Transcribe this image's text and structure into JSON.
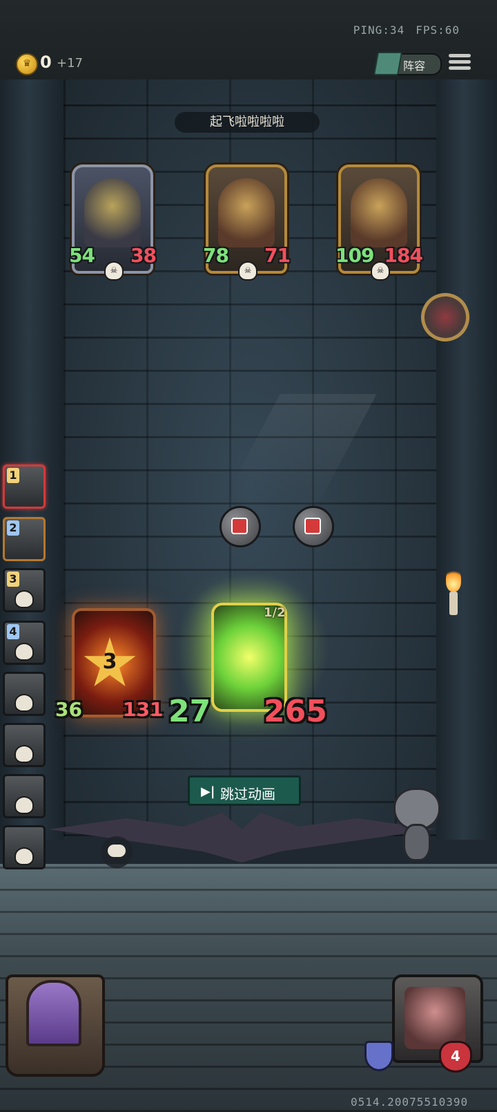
{
  "hud": {
    "ping": "PING:34",
    "fps": "FPS:60",
    "coins": "0",
    "coin_delta": "+17",
    "lineup_label": "阵容"
  },
  "banner": "起飞啦啦啦啦",
  "enemies": [
    {
      "atk": "54",
      "hp": "38"
    },
    {
      "atk": "78",
      "hp": "71"
    },
    {
      "atk": "109",
      "hp": "184"
    }
  ],
  "queue": [
    "1",
    "2",
    "3",
    "4"
  ],
  "combat": {
    "star_value": "3",
    "left_atk": "36",
    "left_hp": "131",
    "right_atk": "27",
    "right_hp": "265",
    "attack_counter": "1/2"
  },
  "skip_button": {
    "icon": "▶|",
    "label": "跳过动画"
  },
  "player": {
    "health": "4"
  },
  "build_id": "0514.20075510390",
  "icons": {
    "coin": "crown-coin-icon",
    "menu": "hamburger-menu-icon",
    "lineup": "book-icon",
    "chat": "chat-bubble-icon",
    "shield": "shield-icon",
    "heart": "heart-icon"
  }
}
